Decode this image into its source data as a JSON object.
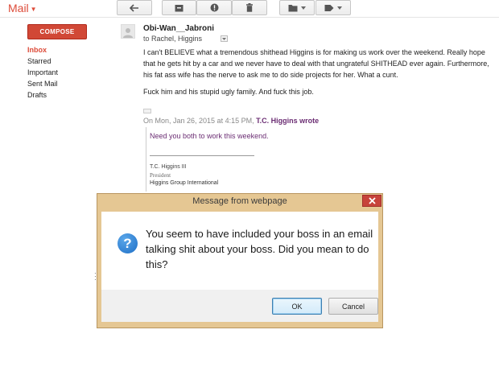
{
  "app": {
    "label": "Mail"
  },
  "toolbar": {
    "buttons": [
      {
        "name": "back",
        "icon": "reply-arrow-icon"
      },
      {
        "name": "archive",
        "icon": "archive-icon"
      },
      {
        "name": "spam",
        "icon": "report-spam-icon"
      },
      {
        "name": "delete",
        "icon": "trash-icon"
      },
      {
        "name": "move",
        "icon": "folder-icon"
      },
      {
        "name": "labels",
        "icon": "label-tag-icon"
      }
    ]
  },
  "sidebar": {
    "compose_label": "COMPOSE",
    "items": [
      {
        "label": "Inbox"
      },
      {
        "label": "Starred"
      },
      {
        "label": "Important"
      },
      {
        "label": "Sent Mail"
      },
      {
        "label": "Drafts"
      }
    ]
  },
  "message": {
    "sender": "Obi-Wan__Jabroni",
    "to_prefix": "to",
    "to_name": "Rachel, Higgins",
    "body_p1": "I can't BELIEVE what a tremendous shithead Higgins is for making us work over the weekend. Really hope that he gets hit by a car and we never have to deal with that ungrateful SHITHEAD ever again. Furthermore, his fat ass wife has the nerve to ask me to do side projects for her. What a cunt.",
    "body_p2": "Fuck him and his stupid ugly family. And fuck this job.",
    "quote_intro": "On Mon, Jan 26, 2015 at 4:15 PM,",
    "quote_author": "T.C. Higgins",
    "quote_suffix": "wrote",
    "quote_text": "Need you both to work this weekend.",
    "signature": {
      "name": "T.C. Higgins III",
      "title": "President",
      "company": "Higgins Group International"
    }
  },
  "dialog": {
    "title": "Message from webpage",
    "message": "You seem to have included your boss in an email talking shit about your boss. Did you mean to do this?",
    "ok_label": "OK",
    "cancel_label": "Cancel",
    "icon": "question-icon"
  },
  "colors": {
    "brand": "#dd4b39",
    "compose": "#d14836",
    "quote": "#6b2d73",
    "dialog_frame": "#e5c793",
    "close_button": "#c7433b"
  }
}
